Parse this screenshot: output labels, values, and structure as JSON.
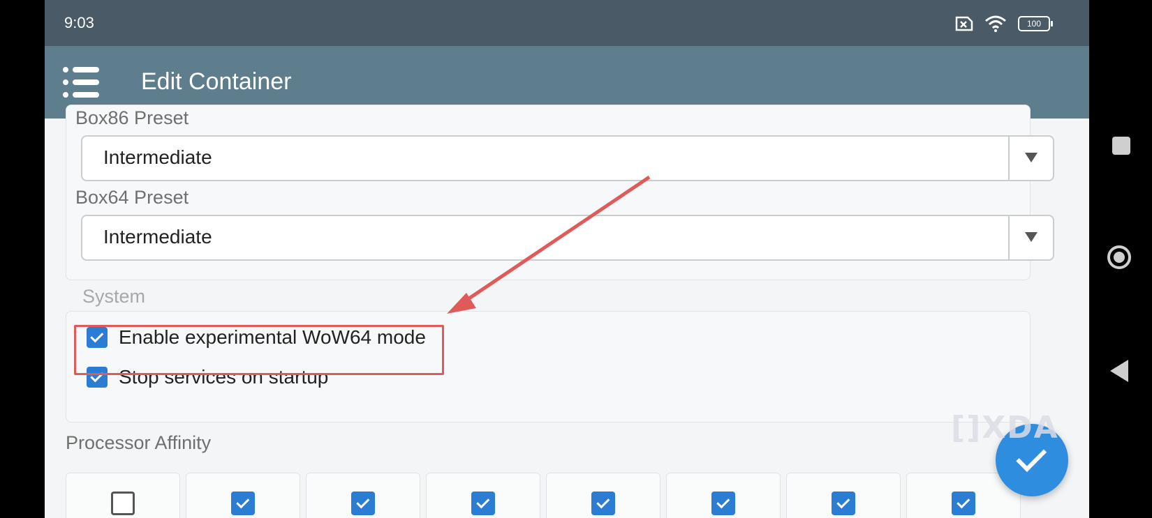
{
  "status_bar": {
    "time": "9:03",
    "battery": "100"
  },
  "app_bar": {
    "title": "Edit Container",
    "menu_icon": "list-menu-icon"
  },
  "presets": {
    "box86_label": "Box86 Preset",
    "box86_value": "Intermediate",
    "box64_label": "Box64 Preset",
    "box64_value": "Intermediate"
  },
  "system": {
    "legend": "System",
    "options": [
      {
        "label": "Enable experimental WoW64 mode",
        "checked": true
      },
      {
        "label": "Stop services on startup",
        "checked": true
      }
    ]
  },
  "processor_affinity": {
    "label": "Processor Affinity",
    "cpus": [
      false,
      true,
      true,
      true,
      true,
      true,
      true,
      true
    ]
  },
  "watermark": "[]XDA",
  "colors": {
    "accent": "#2b7dd3",
    "appbar": "#5f7e8d",
    "statusbar": "#4a5b67",
    "highlight": "#e05a5a",
    "arrow": "#e05a5a"
  }
}
